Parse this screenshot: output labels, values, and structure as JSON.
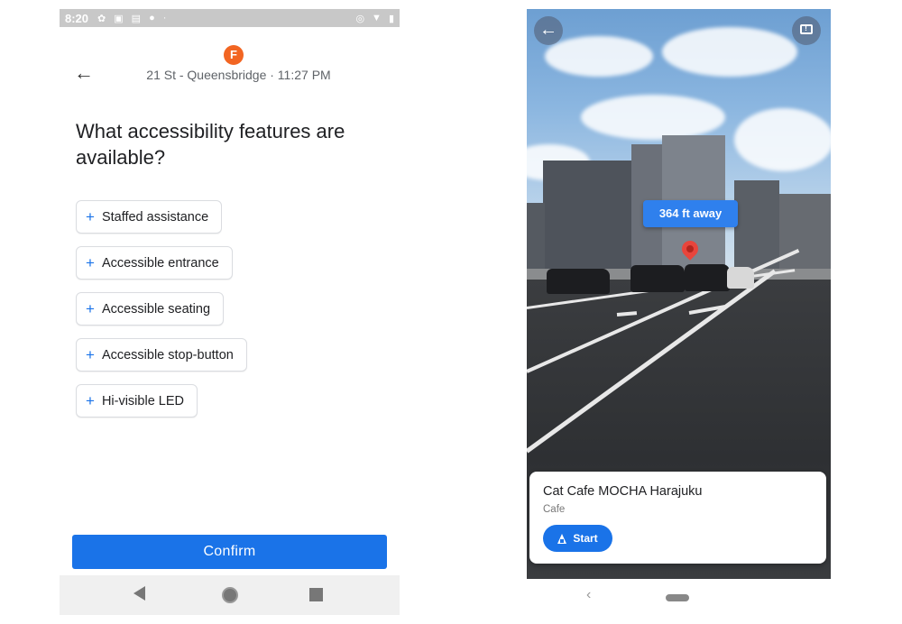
{
  "left_screen": {
    "status_bar": {
      "time": "8:20",
      "icons": [
        "settings-icon",
        "notification-icon",
        "photo-icon",
        "location-icon",
        "dot-icon"
      ],
      "right_icons": [
        "nfc-icon",
        "wifi-icon",
        "battery-icon"
      ]
    },
    "header": {
      "line_badge": "F",
      "line_color": "#f26522",
      "station_info": "21 St - Queensbridge · 11:27 PM"
    },
    "question": "What accessibility features are available?",
    "chips": [
      {
        "label": "Staffed assistance"
      },
      {
        "label": "Accessible entrance"
      },
      {
        "label": "Accessible seating"
      },
      {
        "label": "Accessible stop-button"
      },
      {
        "label": "Hi-visible LED"
      }
    ],
    "confirm_label": "Confirm",
    "accent": "#1a73e8"
  },
  "right_screen": {
    "distance_label": "364 ft away",
    "place": {
      "name": "Cat Cafe MOCHA Harajuku",
      "type": "Cafe",
      "start_label": "Start"
    },
    "accent": "#1a73e8",
    "pin_color": "#e8453c"
  }
}
